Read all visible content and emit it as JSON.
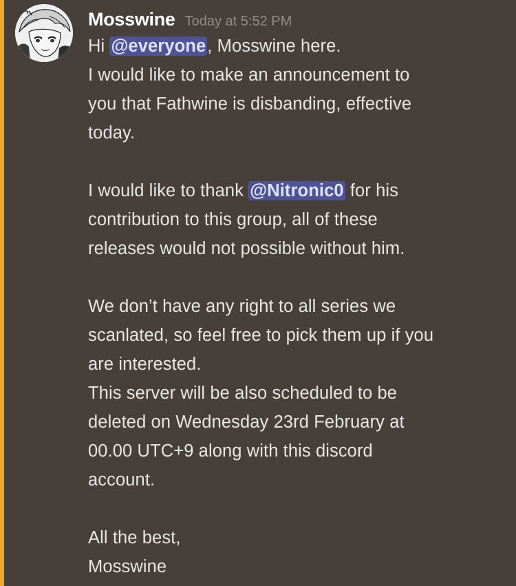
{
  "message": {
    "author": "Mosswine",
    "timestamp": "Today at 5:52 PM",
    "avatar_icon": "anime-character-avatar",
    "colors": {
      "background": "#473f3a",
      "highlight_bar": "#f0a52b",
      "mention_background": "#4f5293",
      "mention_text": "#dfe0fb"
    },
    "lines": {
      "l1_before": "Hi ",
      "l1_mention": "@everyone",
      "l1_after": ", Mosswine here.",
      "l2": "I would like to make an announcement to",
      "l3": "you that Fathwine is disbanding, effective",
      "l4": "today.",
      "l6_before": "I would like to thank ",
      "l6_mention": "@Nitronic0",
      "l6_after": " for his",
      "l7": "contribution to this group, all of these",
      "l8": "releases would not possible without him.",
      "l10": "We don’t have any right to all series we",
      "l11": "scanlated, so feel free to pick them up if you",
      "l12": "are interested.",
      "l13": "This server will be also scheduled to be",
      "l14": "deleted on Wednesday 23rd February at",
      "l15": "00.00 UTC+9 along with this discord",
      "l16": "account.",
      "l18": "All the best,",
      "l19": "Mosswine"
    }
  }
}
